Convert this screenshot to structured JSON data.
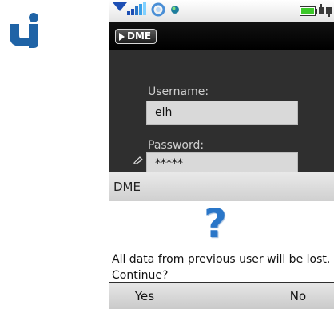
{
  "logo": {
    "name": "ui-logo"
  },
  "colors": {
    "accent": "#2a76c8",
    "logo": "#1f63a6",
    "battery": "#3cc82a"
  },
  "header": {
    "app_name": "DME"
  },
  "form": {
    "username_label": "Username:",
    "username_value": "elh",
    "password_label": "Password:",
    "password_value": "*****"
  },
  "dialog": {
    "title": "DME",
    "icon": "question-icon",
    "message": "All data from previous user will be lost. Continue?",
    "yes_label": "Yes",
    "no_label": "No"
  }
}
